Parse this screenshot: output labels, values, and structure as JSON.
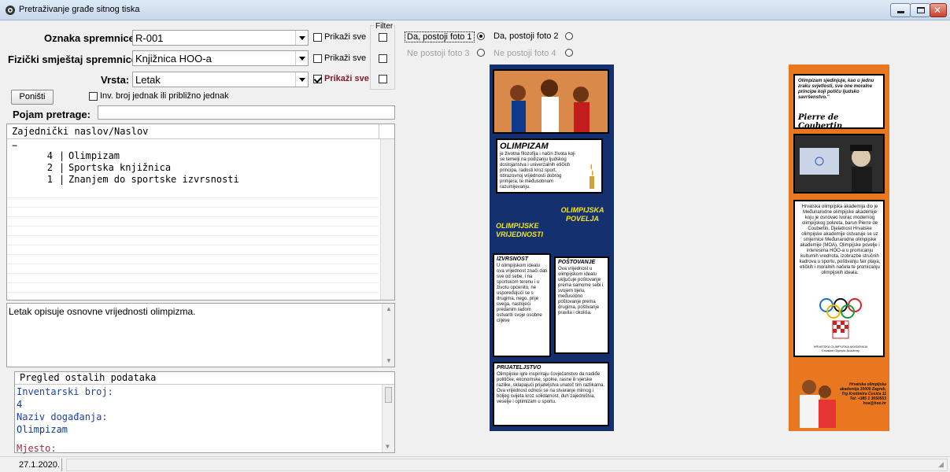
{
  "window": {
    "title": "Pretraživanje građe sitnog tiska",
    "icon": "app-icon",
    "controls": [
      "minimize-icon",
      "maximize-icon",
      "close-icon"
    ]
  },
  "filter_group_label": "Filter",
  "fields": {
    "oznaka": {
      "label": "Oznaka spremnice:",
      "value": "R-001",
      "show_all_label": "Prikaži sve",
      "show_all_checked": false
    },
    "smjestaj": {
      "label": "Fizički smještaj spremnice:",
      "value": "Knjižnica HOO-a",
      "show_all_label": "Prikaži sve",
      "show_all_checked": false
    },
    "vrsta": {
      "label": "Vrsta:",
      "value": "Letak",
      "show_all_label": "Prikaži sve",
      "show_all_checked": true
    }
  },
  "reset_button": "Poništi",
  "inv_checkbox_label": "Inv. broj jednak ili približno jednak",
  "search": {
    "label": "Pojam pretrage:",
    "value": ""
  },
  "list": {
    "header": "Zajednički naslov/Naslov",
    "first_row": "−",
    "rows": [
      {
        "count": "4",
        "title": "Olimpizam"
      },
      {
        "count": "2",
        "title": "Sportska knjižnica"
      },
      {
        "count": "1",
        "title": "Znanjem do sportske izvrsnosti"
      }
    ]
  },
  "description": "Letak opisuje osnovne vrijednosti olimpizma.",
  "details": {
    "header": "Pregled ostalih podataka",
    "lines": [
      {
        "label": "Inventarski broj:",
        "value": "4"
      },
      {
        "label": "Naziv događanja:",
        "value": "Olimpizam"
      },
      {
        "label": "Mjesto:",
        "value": ""
      }
    ]
  },
  "photos": {
    "foto1": "Da, postoji foto 1",
    "foto2": "Da, postoji foto 2",
    "foto3": "Ne postoji foto 3",
    "foto4": "Ne postoji foto 4"
  },
  "status": {
    "date": "27.1.2020."
  },
  "poster_left": {
    "title": "OLIMPIZAM",
    "intro": "je životna filozofija i način života koji se temelji na podizanju ljudskog dostojanstva i univerzalnih etičkih principa, radosti kroz sport, obrazovnoj vrijednosti dobrog primjera, te međusobnom razumijevanju.",
    "charter": "OLIMPIJSKA POVELJA",
    "values": "OLIMPIJSKE VRIJEDNOSTI",
    "izvrsnost_title": "IZVRSNOST",
    "izvrsnost": "U olimpijskom idealu ova vrijednost znači dati sve od sebe, i na sportskom terenu i u životu općenito, ne uspoređujući se s drugima, nego, prije svega, nastojeći predanim radom ostvariti svoje osobne ciljeve",
    "postovanje_title": "POŠTOVANJE",
    "postovanje": "Ova vrijednost u olimpijskom idealu uključuje poštovanje prema samome sebi i svojem tijelu, međusobno poštovanje prema drugima, poštivanje pravila i okoliša.",
    "prijateljstvo_title": "PRIJATELJSTVO",
    "prijateljstvo": "Olimpijske igre inspiriraju čovječanstvo da nadiđe političke, ekonomske, spolne, rasne ili vjerske razlike, sklapajući prijateljstva unatoč tim razlikama. Ova vrijednost odnosi se na stvaranje mirnog i boljeg svijeta kroz solidarnost, duh zajedništva, veselje i optimizam u sportu."
  },
  "poster_right": {
    "quote": "Olimpizam sjedinjuje, kao u jednu zraku svjetlosti, sve one moralne principe koji potiču ljudsko savršenstvo.\"",
    "signature": "Pierre de Coubertin",
    "body": "Hrvatska olimpijska akademija dio je Međunarodne olimpijske akademije koju je osnovao tvorac modernog olimpijskog pokreta, barun Pierre de Coubertin. Djelatnost Hrvatske olimpijske akademije ostvaruje se uz smjernice Međunarodne olimpijske akademije (MOA), Olimpijske povelje i interesima HOO-a u promicanju kulturnih vrednota, izobrazbe stručnih kadrova u sportu, poštivanju fair playa, etičkih i moralnih načela te promicanju olimpijskih ideala.",
    "academy": "HRVATSKA OLIMPIJSKA AKADEMIJA Croatian Olympic Academy",
    "address": "Hrvatska olimpijska akademija 10000 Zagreb, Trg Krešimira Ćosića 11 Tel: +385 1 3650553 hoa@hoo.hr"
  },
  "colors": {
    "poster_left_bg": "#15306f",
    "poster_right_bg": "#e9771f",
    "accent_yellow": "#f5e51c",
    "checked_text": "#8b1a2a"
  }
}
